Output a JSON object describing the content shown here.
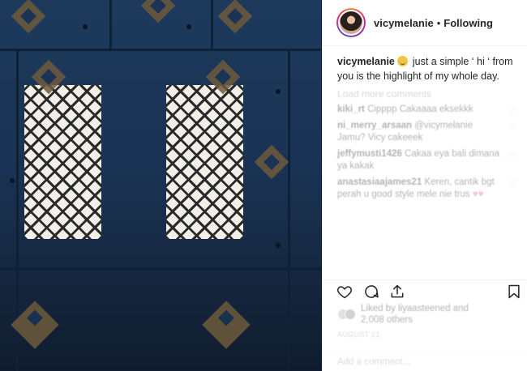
{
  "post": {
    "username": "vicymelanie",
    "separator": "•",
    "follow_status": "Following",
    "caption": {
      "username": "vicymelanie",
      "text": " just a simple ‘ hi ‘ from you is the highlight of my whole day."
    },
    "load_more": "Load more comments",
    "comments": [
      {
        "username": "kiki_rt",
        "text": " Cipppp Cakaaaa eksekkk"
      },
      {
        "username": "ni_merry_arsaan",
        "text": " @vicymelanie Jamu? Vicy cakeeek"
      },
      {
        "username": "jeffymusti1426",
        "text": " Cakaa eya bali dimana ya kakak"
      },
      {
        "username": "anastasiaajames21",
        "text": " Keren, cantik bgt perah u good style mele nie trus "
      }
    ],
    "likes_text": "Liked by liyaasteened and 2,008 others",
    "timestamp": "AUGUST 21",
    "add_comment_placeholder": "Add a comment..."
  },
  "colors": {
    "text": "#262626",
    "secondary": "#8e8e8e",
    "border": "#efefef"
  },
  "icons": [
    "heart-icon",
    "comment-icon",
    "share-icon",
    "bookmark-icon"
  ]
}
